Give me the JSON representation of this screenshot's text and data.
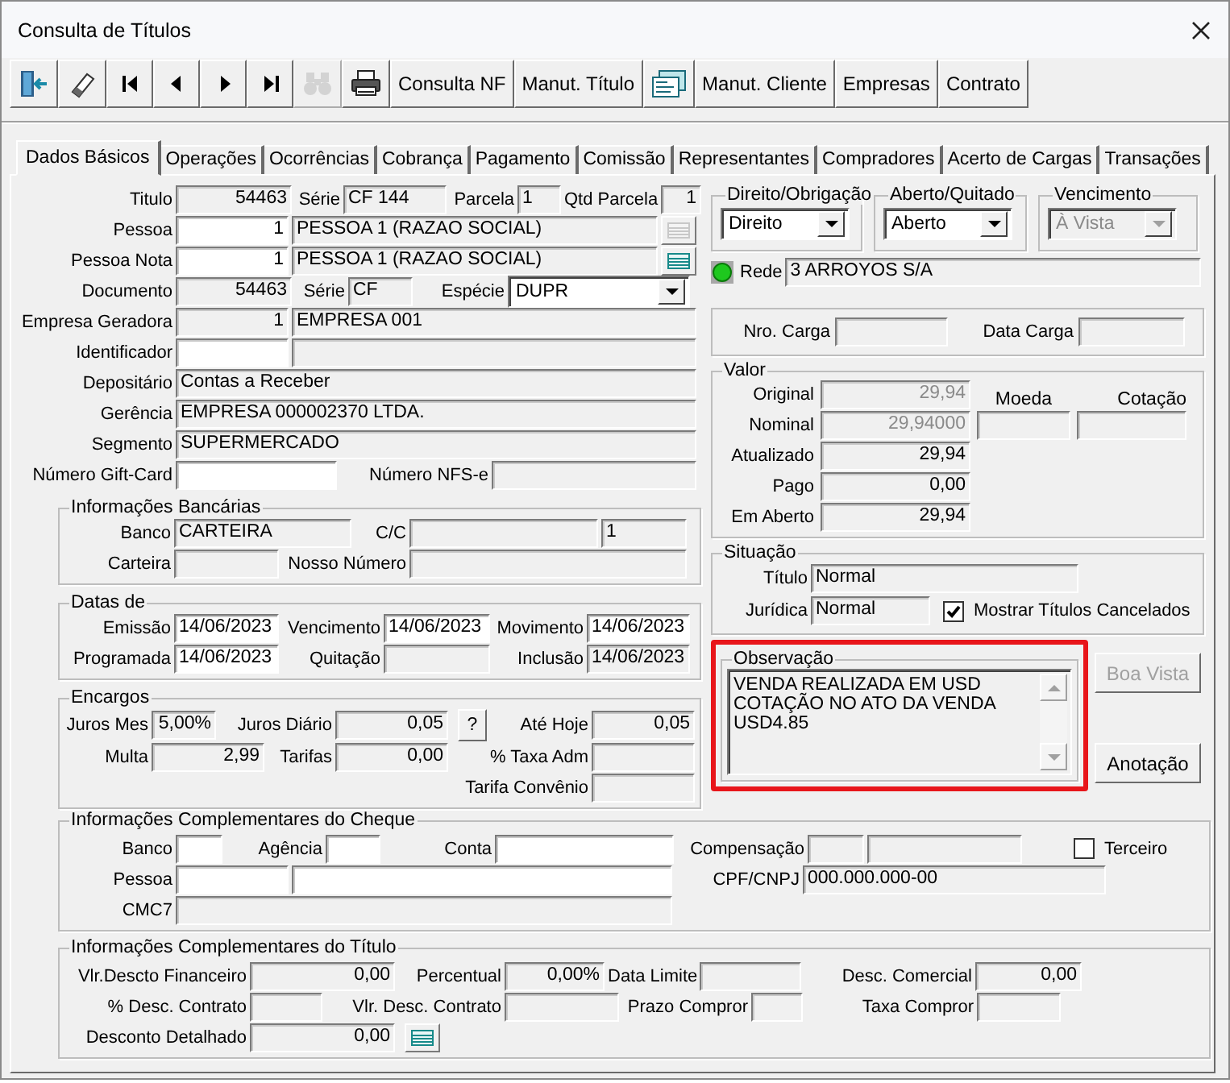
{
  "window": {
    "title": "Consulta de Títulos"
  },
  "toolbar": [
    {
      "kind": "icon",
      "disabled": false
    },
    {
      "kind": "icon",
      "disabled": false
    },
    {
      "kind": "icon",
      "disabled": false
    },
    {
      "kind": "icon",
      "disabled": false
    },
    {
      "kind": "icon",
      "disabled": false
    },
    {
      "kind": "icon",
      "disabled": false
    },
    {
      "kind": "icon",
      "disabled": true
    },
    {
      "kind": "icon",
      "disabled": false
    },
    {
      "kind": "text",
      "label": "Consulta NF"
    },
    {
      "kind": "text",
      "label": "Manut. Título"
    },
    {
      "kind": "icon",
      "disabled": false
    },
    {
      "kind": "text",
      "label": "Manut. Cliente"
    },
    {
      "kind": "text",
      "label": "Empresas"
    },
    {
      "kind": "text",
      "label": "Contrato"
    }
  ],
  "tabs": [
    {
      "label": "Dados Básicos",
      "selected": true
    },
    {
      "label": "Operações",
      "selected": false
    },
    {
      "label": "Ocorrências",
      "selected": false
    },
    {
      "label": "Cobrança",
      "selected": false
    },
    {
      "label": "Pagamento",
      "selected": false
    },
    {
      "label": "Comissão",
      "selected": false
    },
    {
      "label": "Representantes",
      "selected": false
    },
    {
      "label": "Compradores",
      "selected": false
    },
    {
      "label": "Acerto de Cargas",
      "selected": false
    },
    {
      "label": "Transações",
      "selected": false
    }
  ],
  "basic": {
    "titulo": {
      "label": "Titulo",
      "value": "54463",
      "readonly": true
    },
    "serie": {
      "label": "Série",
      "value": "CF 144",
      "readonly": true
    },
    "parcela": {
      "label": "Parcela",
      "value": "1",
      "readonly": true
    },
    "qtd_parcela": {
      "label": "Qtd Parcela",
      "value": "1",
      "readonly": true
    },
    "pessoa": {
      "label": "Pessoa",
      "value": "1",
      "readonly": false
    },
    "pessoa_nome": {
      "value": "PESSOA 1 (RAZAO SOCIAL)",
      "readonly": true
    },
    "pessoa_list_button": {
      "disabled": true
    },
    "pessoa_nota": {
      "label": "Pessoa Nota",
      "value": "1",
      "readonly": false
    },
    "pessoa_nota_nome": {
      "value": "PESSOA 1 (RAZAO SOCIAL)",
      "readonly": true
    },
    "pessoa_nota_list_button": {
      "disabled": false
    },
    "documento": {
      "label": "Documento",
      "value": "54463",
      "readonly": true
    },
    "documento_serie": {
      "label": "Série",
      "value": "CF",
      "readonly": true
    },
    "especie": {
      "label": "Espécie",
      "value": "DUPR",
      "disabled": false
    },
    "empresa_geradora": {
      "label": "Empresa Geradora",
      "value": "1",
      "readonly": true
    },
    "empresa_nome": {
      "value": "EMPRESA 001",
      "readonly": true
    },
    "identificador": {
      "label": "Identificador",
      "readonly": false
    },
    "identificador_desc": {
      "readonly": true
    },
    "depositario": {
      "label": "Depositário",
      "value": "Contas a Receber",
      "readonly": true
    },
    "gerencia": {
      "label": "Gerência",
      "value": "EMPRESA 000002370 LTDA.",
      "readonly": true
    },
    "segmento": {
      "label": "Segmento",
      "value": "SUPERMERCADO",
      "readonly": true
    },
    "gift_card": {
      "label": "Número Gift-Card",
      "readonly": false
    },
    "nfse": {
      "label": "Número NFS-e",
      "readonly": true
    }
  },
  "bank": {
    "legend": "Informações Bancárias",
    "banco": {
      "label": "Banco",
      "value": "CARTEIRA",
      "readonly": true
    },
    "cc": {
      "label": "C/C",
      "readonly": true
    },
    "cc_digito": {
      "value": "1",
      "readonly": true
    },
    "carteira": {
      "label": "Carteira",
      "readonly": true
    },
    "nosso_numero": {
      "label": "Nosso Número",
      "readonly": true
    }
  },
  "dates": {
    "legend": "Datas de",
    "emissao": {
      "label": "Emissão",
      "value": "14/06/2023",
      "readonly": false
    },
    "vencimento": {
      "label": "Vencimento",
      "value": "14/06/2023",
      "readonly": false
    },
    "movimento": {
      "label": "Movimento",
      "value": "14/06/2023",
      "readonly": false
    },
    "programada": {
      "label": "Programada",
      "value": "14/06/2023",
      "readonly": false
    },
    "quitacao": {
      "label": "Quitação",
      "readonly": true
    },
    "inclusao": {
      "label": "Inclusão",
      "value": "14/06/2023",
      "readonly": true
    }
  },
  "charges": {
    "legend": "Encargos",
    "juros_mes": {
      "label": "Juros Mes",
      "value": "5,00%",
      "readonly": true
    },
    "juros_diario": {
      "label": "Juros Diário",
      "value": "0,05",
      "readonly": true
    },
    "help_button": {
      "label": "?"
    },
    "ate_hoje": {
      "label": "Até Hoje",
      "value": "0,05",
      "readonly": true
    },
    "multa": {
      "label": "Multa",
      "value": "2,99",
      "readonly": true
    },
    "tarifas": {
      "label": "Tarifas",
      "value": "0,00",
      "readonly": true
    },
    "taxa_adm": {
      "label": "% Taxa Adm",
      "readonly": true
    },
    "tarifa_convenio": {
      "label": "Tarifa Convênio",
      "readonly": true
    }
  },
  "flags": [
    {
      "legend": "Direito/Obrigação",
      "value": "Direito",
      "disabled": false
    },
    {
      "legend": "Aberto/Quitado",
      "value": "Aberto",
      "disabled": false
    },
    {
      "legend": "Vencimento",
      "value": "À Vista",
      "disabled": true
    }
  ],
  "rede": {
    "label": "Rede",
    "value": "3 ARROYOS S/A",
    "readonly": true
  },
  "carga": {
    "nro_carga": {
      "label": "Nro. Carga",
      "readonly": true
    },
    "data_carga": {
      "label": "Data Carga",
      "readonly": true
    }
  },
  "valor": {
    "legend": "Valor",
    "original": {
      "label": "Original",
      "value": "29,94",
      "readonly": true,
      "disabled": true
    },
    "moeda_header": "Moeda",
    "cotacao_header": "Cotação",
    "nominal": {
      "label": "Nominal",
      "value": "29,94000",
      "readonly": true,
      "disabled": true
    },
    "moeda": {
      "readonly": true
    },
    "cotacao": {
      "readonly": true
    },
    "atualizado": {
      "label": "Atualizado",
      "value": "29,94",
      "readonly": true
    },
    "pago": {
      "label": "Pago",
      "value": "0,00",
      "readonly": true
    },
    "em_aberto": {
      "label": "Em Aberto",
      "value": "29,94",
      "readonly": true
    }
  },
  "situacao": {
    "legend": "Situação",
    "titulo": {
      "label": "Título",
      "value": "Normal",
      "readonly": true
    },
    "juridica": {
      "label": "Jurídica",
      "value": "Normal",
      "readonly": true
    },
    "mostrar_cancelados": {
      "label": "Mostrar Títulos Cancelados",
      "checked": true
    }
  },
  "observacao": {
    "legend": "Observação",
    "lines": [
      "VENDA REALIZADA EM USD",
      "COTAÇÃO NO ATO DA VENDA",
      "USD4.85"
    ]
  },
  "side_buttons": [
    {
      "label": "Boa Vista",
      "disabled": true
    },
    {
      "label": "Anotação",
      "disabled": false
    }
  ],
  "cheque": {
    "legend": "Informações Complementares do Cheque",
    "banco": {
      "label": "Banco",
      "readonly": false
    },
    "agencia": {
      "label": "Agência",
      "readonly": false
    },
    "conta": {
      "label": "Conta",
      "readonly": false
    },
    "compensacao": {
      "label": "Compensação",
      "readonly": true
    },
    "compensacao_desc": {
      "readonly": true
    },
    "terceiro": {
      "label": "Terceiro",
      "checked": false
    },
    "pessoa": {
      "label": "Pessoa",
      "readonly": false
    },
    "pessoa_nome": {
      "readonly": false
    },
    "cpf_cnpj": {
      "label": "CPF/CNPJ",
      "value": "000.000.000-00",
      "readonly": true
    },
    "cmc7": {
      "label": "CMC7",
      "readonly": true
    }
  },
  "titulo_info": {
    "legend": "Informações Complementares do Título",
    "vlr_descto_financeiro": {
      "label": "Vlr.Descto Financeiro",
      "value": "0,00",
      "readonly": true
    },
    "percentual": {
      "label": "Percentual",
      "value": "0,00%",
      "readonly": true
    },
    "data_limite": {
      "label": "Data Limite",
      "readonly": true
    },
    "desc_comercial": {
      "label": "Desc. Comercial",
      "value": "0,00",
      "readonly": true
    },
    "pct_desc_contrato": {
      "label": "% Desc. Contrato",
      "readonly": true
    },
    "vlr_desc_contrato": {
      "label": "Vlr. Desc. Contrato",
      "readonly": true
    },
    "prazo_compror": {
      "label": "Prazo Compror",
      "readonly": true
    },
    "taxa_compror": {
      "label": "Taxa Compror",
      "readonly": true
    },
    "desconto_detalhado": {
      "label": "Desconto Detalhado",
      "value": "0,00",
      "readonly": true
    },
    "desconto_list_button": {
      "disabled": false
    }
  }
}
